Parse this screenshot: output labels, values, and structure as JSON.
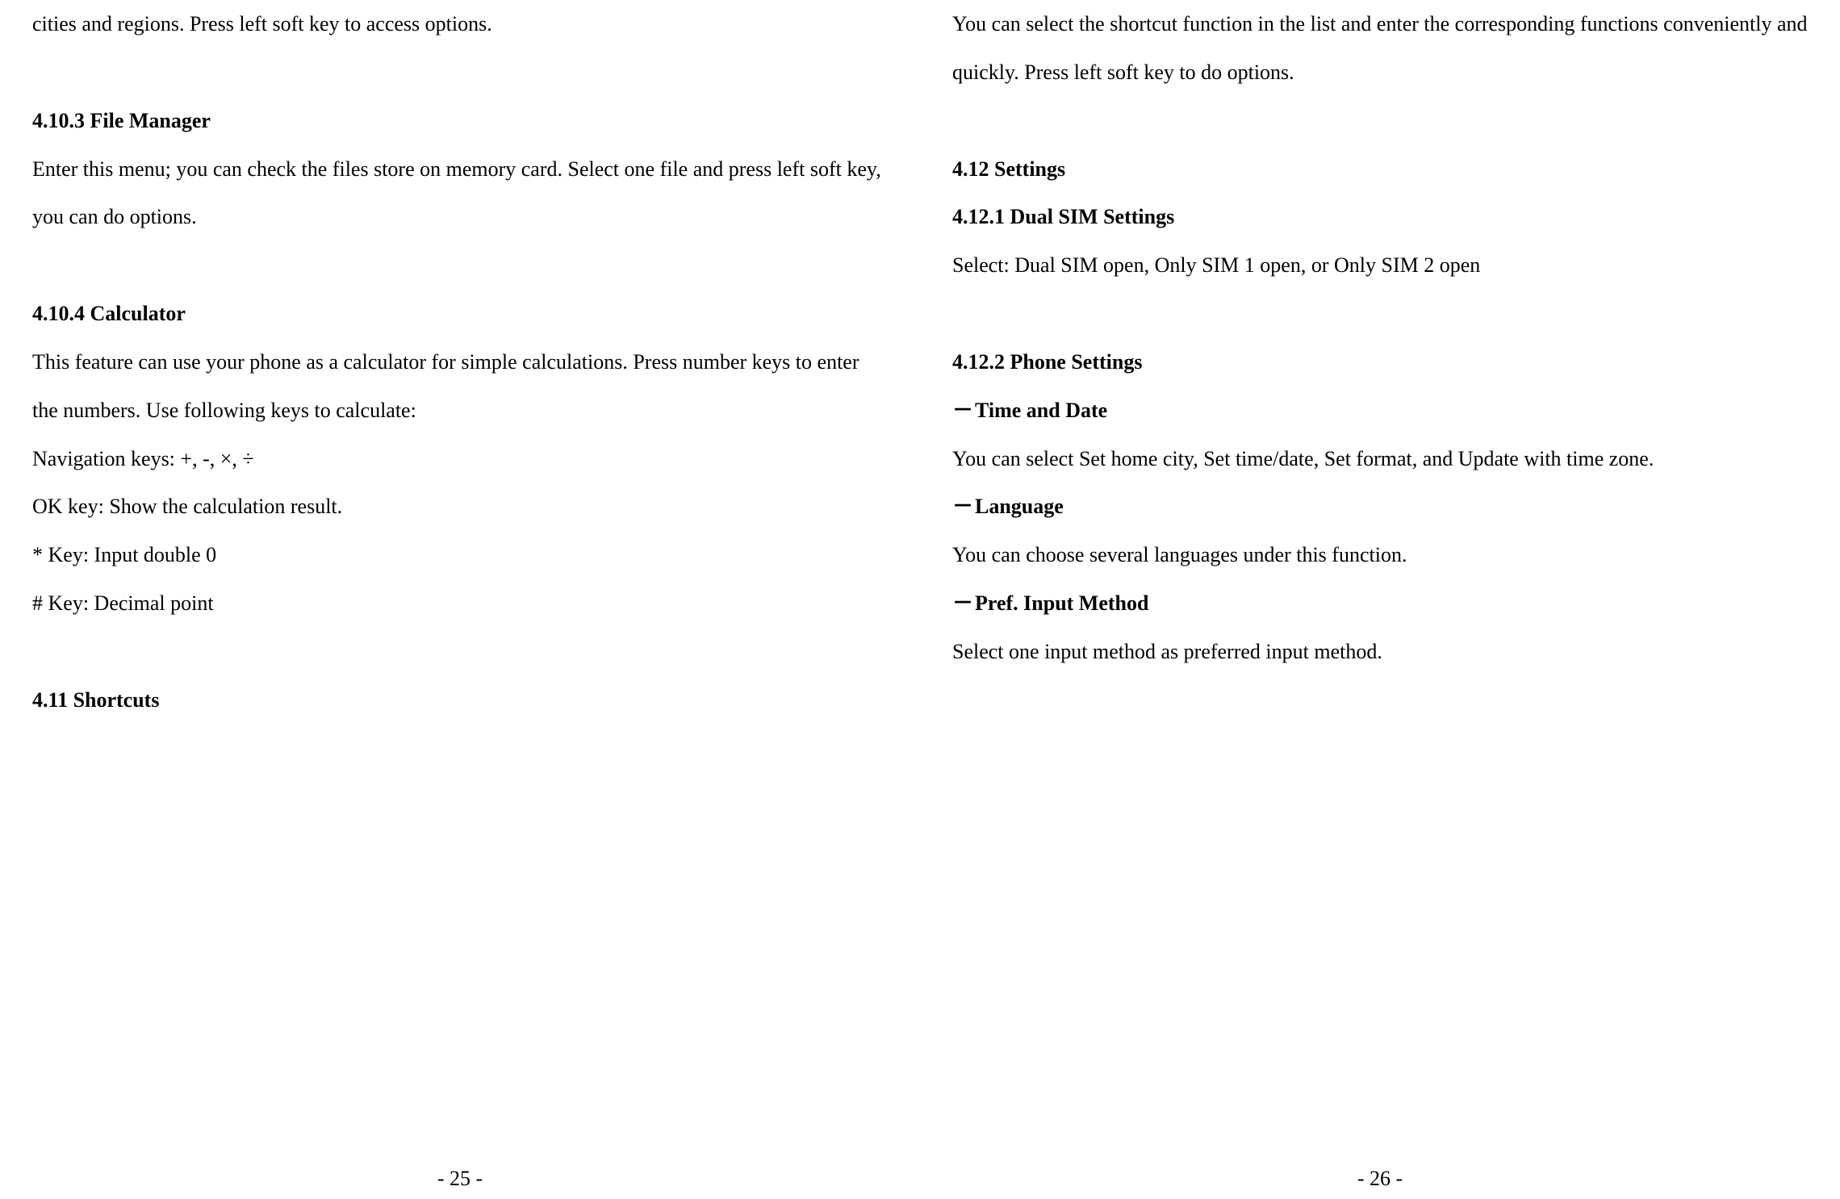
{
  "leftPage": {
    "intro": "cities and regions. Press left soft key to access options.",
    "section1": {
      "heading": "4.10.3 File Manager",
      "body": "Enter this menu; you can check the files store on memory card. Select one file and press left soft key, you can do options."
    },
    "section2": {
      "heading": "4.10.4 Calculator",
      "body1": "This feature can use your phone as a calculator for simple calculations. Press number keys to enter the numbers. Use following keys to calculate:",
      "line1": "Navigation keys: +, -, ×, ÷",
      "line2": "OK key: Show the calculation result.",
      "line3": "* Key: Input double 0",
      "line4": "# Key: Decimal point"
    },
    "section3": {
      "heading": "4.11 Shortcuts"
    },
    "pageNumber": "- 25 -"
  },
  "rightPage": {
    "intro": "You can select the shortcut function in the list and enter the corresponding functions conveniently and quickly. Press left soft key to do options.",
    "section1": {
      "heading": "4.12 Settings",
      "subheading": "4.12.1 Dual SIM Settings",
      "body": "Select: Dual SIM open, Only SIM 1 open, or Only SIM 2 open"
    },
    "section2": {
      "heading": "4.12.2 Phone Settings",
      "item1": {
        "label": "Time and Date",
        "body": "You can select Set home city, Set time/date, Set format, and Update with time zone."
      },
      "item2": {
        "label": "Language",
        "body": "You can choose several languages under this function."
      },
      "item3": {
        "label": "Pref. Input Method",
        "body": "Select one input method as preferred input method."
      }
    },
    "pageNumber": "- 26 -"
  }
}
